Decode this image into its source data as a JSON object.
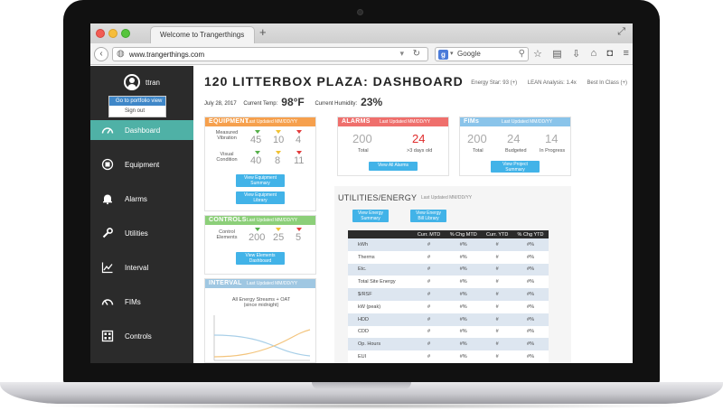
{
  "browser": {
    "tab_title": "Welcome to Trangerthings",
    "new_tab": "+",
    "url": "www.trangerthings.com",
    "search_engine": "Google"
  },
  "user": {
    "name": "ttran",
    "menu": [
      "Go to portfolio view",
      "Sign out"
    ]
  },
  "sidebar": {
    "items": [
      {
        "label": "Dashboard",
        "icon": "gauge-icon",
        "active": true
      },
      {
        "label": "Equipment",
        "icon": "equipment-icon"
      },
      {
        "label": "Alarms",
        "icon": "bell-icon"
      },
      {
        "label": "Utilities",
        "icon": "wrench-icon"
      },
      {
        "label": "Interval",
        "icon": "line-chart-icon"
      },
      {
        "label": "FIMs",
        "icon": "gauge-icon"
      },
      {
        "label": "Controls",
        "icon": "controls-icon"
      }
    ]
  },
  "page": {
    "title": "120 LITTERBOX PLAZA: DASHBOARD",
    "date": "July 28, 2017",
    "temp_label": "Current Temp:",
    "temp_value": "98°F",
    "humidity_label": "Current Humidity:",
    "humidity_value": "23%",
    "links": [
      "Energy Star: 93 (+)",
      "LEAN Analysis: 1.4x",
      "Best In Class (+)"
    ]
  },
  "equipment": {
    "title": "EQUIPMENT",
    "updated": "Last Updated MM/DD/YY",
    "rows": [
      {
        "label_1": "Measured",
        "label_2": "Vibration",
        "values": [
          "45",
          "10",
          "4"
        ]
      },
      {
        "label_1": "Visual",
        "label_2": "Condition",
        "values": [
          "40",
          "8",
          "11"
        ]
      }
    ],
    "btn_summary": [
      "View Equipment",
      "Summary"
    ],
    "btn_library": [
      "View Equipment",
      "Library"
    ]
  },
  "controls": {
    "title": "CONTROLS",
    "updated": "Last Updated MM/DD/YY",
    "label_1": "Control",
    "label_2": "Elements",
    "values": [
      "200",
      "25",
      "5"
    ],
    "btn": [
      "View Elements",
      "Dashboard"
    ]
  },
  "interval": {
    "title": "INTERVAL",
    "updated": "Last Updated MM/DD/YY",
    "chart_title": "All Energy Streams + OAT",
    "chart_sub": "(since midnight)"
  },
  "alarms": {
    "title": "ALARMS",
    "updated": "Last Updated MM/DD/YY",
    "total": "200",
    "total_label": "Total",
    "old": "24",
    "old_label": ">3 days old",
    "btn": "View All Alarms"
  },
  "fims": {
    "title": "FIMs",
    "updated": "Last Updated MM/DD/YY",
    "total": "200",
    "total_label": "Total",
    "budgeted": "24",
    "budgeted_label": "Budgeted",
    "progress": "14",
    "progress_label": "In Progress",
    "btn": [
      "View Project",
      "Summary"
    ]
  },
  "utilities": {
    "title": "UTILITIES/ENERGY",
    "updated": "Last Updated MM/DD/YY",
    "btn_summary": [
      "View Energy",
      "Summary"
    ],
    "btn_library": [
      "View Energy",
      "Bill Library"
    ],
    "columns": [
      "",
      "Curr. MTD",
      "% Chg MTD",
      "Curr. YTD",
      "% Chg YTD"
    ],
    "rows": [
      [
        "kWh",
        "#",
        "#%",
        "#",
        "#%"
      ],
      [
        "Therms",
        "#",
        "#%",
        "#",
        "#%"
      ],
      [
        "Etc.",
        "#",
        "#%",
        "#",
        "#%"
      ],
      [
        "Total Site Energy",
        "#",
        "#%",
        "#",
        "#%"
      ],
      [
        "$/RSF",
        "#",
        "#%",
        "#",
        "#%"
      ],
      [
        "kW (peak)",
        "#",
        "#%",
        "#",
        "#%"
      ],
      [
        "HDD",
        "#",
        "#%",
        "#",
        "#%"
      ],
      [
        "CDD",
        "#",
        "#%",
        "#",
        "#%"
      ],
      [
        "Op. Hours",
        "#",
        "#%",
        "#",
        "#%"
      ],
      [
        "EUI",
        "#",
        "#%",
        "#",
        "#%"
      ]
    ]
  },
  "colors": {
    "accent_teal": "#4fb1a6",
    "equipment_orange": "#f6a04d",
    "alarms_red": "#ef6f6c",
    "fims_blue": "#8ac4ea",
    "controls_green": "#8ccf79",
    "button_blue": "#42b3e8",
    "sidebar_dark": "#2b2b2b"
  }
}
